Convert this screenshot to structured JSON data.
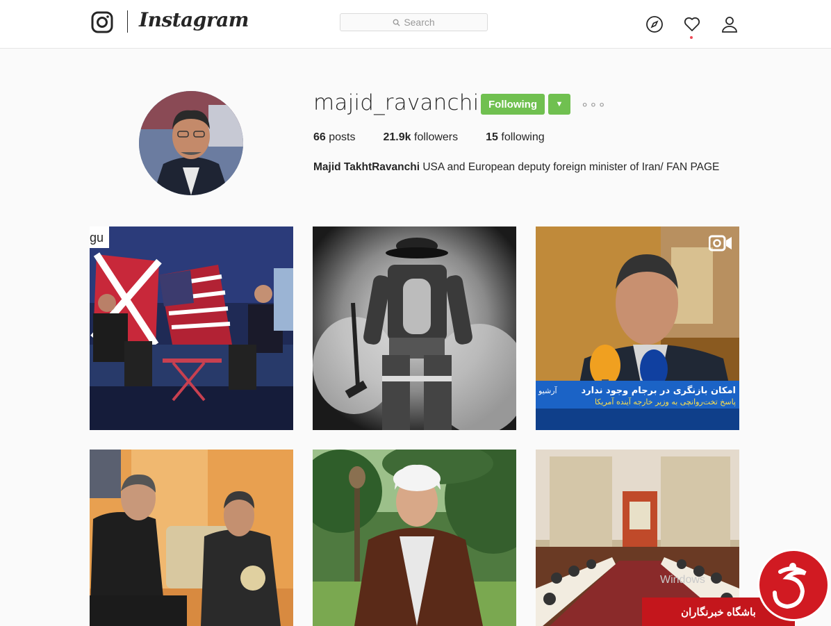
{
  "header": {
    "brand": "Instagram",
    "search_placeholder": "Search",
    "icons": [
      "instagram-glyph-icon",
      "compass-icon",
      "heart-icon",
      "user-icon",
      "search-icon"
    ]
  },
  "profile": {
    "username": "majid_ravanchi",
    "follow_label": "Following",
    "stats": {
      "posts_count": "66",
      "posts_label": "posts",
      "followers_count": "21.9k",
      "followers_label": "followers",
      "following_count": "15",
      "following_label": "following"
    },
    "full_name": "Majid TakhtRavanchi",
    "bio_text": "USA and European deputy foreign minister of Iran/ FAN PAGE"
  },
  "posts": [
    {
      "tag": "gu"
    },
    {},
    {
      "video_icon": "video-camera-icon",
      "ticker_line1": "امکان بازنگری در برجام وجود ندارد",
      "ticker_line2": "پاسخ تخت‌روانچی به وزیر خارجه آینده آمریکا",
      "ticker_left": "آرشیو"
    },
    {},
    {},
    {}
  ],
  "overlays": {
    "windows_watermark": "Windows",
    "news_banner": "باشگاه خبرنگاران"
  },
  "colors": {
    "follow_green": "#70c050",
    "notification_dot": "#ed4956",
    "news_red": "#c4161c"
  }
}
